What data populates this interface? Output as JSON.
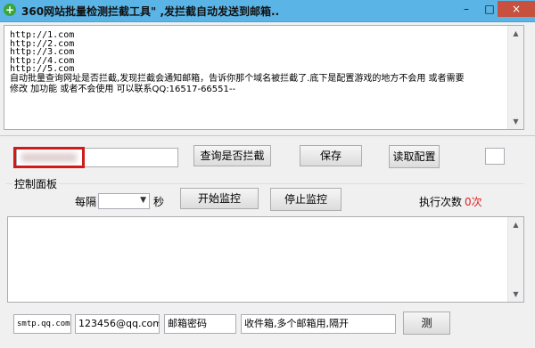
{
  "window": {
    "title": "360网站批量检测拦截工具\"    ,发拦截自动发送到邮箱..",
    "min_label": "–",
    "max_label": "□",
    "close_label": "×"
  },
  "log": {
    "lines": [
      "http://1.com",
      "http://2.com",
      "http://3.com",
      "http://4.com",
      "http://5.com",
      "自动批量查询网址是否拦截,发现拦截会通知邮箱，告诉你那个域名被拦截了.底下是配置游戏的地方不会用 或者需要",
      "修改 加功能 或者不会使用 可以联系QQ:16517-66551--"
    ]
  },
  "toolbar": {
    "domain_input_value": "",
    "query_button": "查询是否拦截",
    "save_button": "保存",
    "load_button": "读取配置"
  },
  "control": {
    "group_title": "控制面板",
    "interval_label": "每隔",
    "interval_value": "",
    "seconds_label": "秒",
    "start_button": "开始监控",
    "stop_button": "停止监控",
    "exec_count_label": "执行次数",
    "exec_count_value": "0次"
  },
  "mail": {
    "smtp_value": "smtp.qq.com",
    "email_value": "123456@qq.com",
    "password_value": "邮箱密码",
    "recipients_value": "收件箱,多个邮箱用,隔开",
    "test_button": "测"
  },
  "colors": {
    "titlebar": "#5bb4e6",
    "close_button": "#c7503e",
    "count_red": "#e02020",
    "highlight_box": "#d11a1a"
  }
}
